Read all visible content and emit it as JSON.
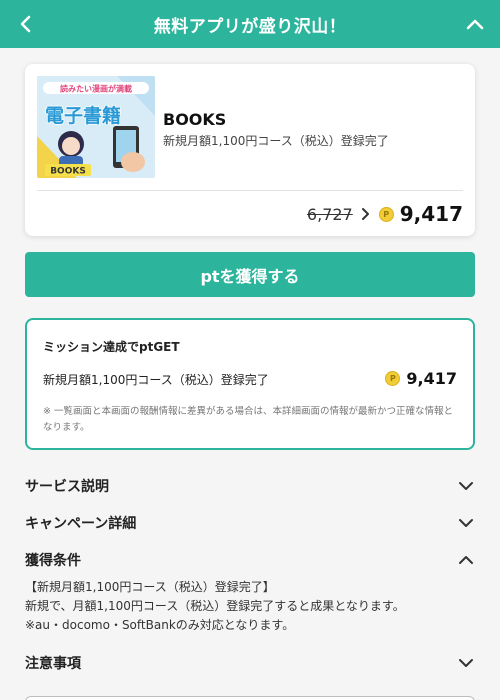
{
  "header": {
    "title": "無料アプリが盛り沢山！",
    "color": "#2cb59c"
  },
  "product": {
    "thumb_text_top": "読みたい漫画が満載",
    "thumb_text_main": "電子書籍",
    "thumb_text_badge": "BOOKS",
    "name": "BOOKS",
    "course": "新規月額1,100円コース（税込）登録完了",
    "old_price": "6,727",
    "new_price": "9,417"
  },
  "cta": {
    "label": "ptを獲得する"
  },
  "mission": {
    "title": "ミッション達成でptGET",
    "course": "新規月額1,100円コース（税込）登録完了",
    "points": "9,417",
    "note": "※ 一覧画面と本画面の報酬情報に差異がある場合は、本詳細画面の情報が最新かつ正確な情報となります。"
  },
  "sections": {
    "service": "サービス説明",
    "campaign": "キャンペーン詳細",
    "conditions": "獲得条件",
    "notes": "注意事項"
  },
  "conditions": {
    "line1": "【新規月額1,100円コース（税込）登録完了】",
    "line2": "新規で、月額1,100円コース（税込）登録完了すると成果となります。",
    "line3": "※au・docomo・SoftBankのみ対応となります。"
  },
  "icons": {
    "back": "chevron-left-icon",
    "collapse": "chevron-up-icon",
    "coin": "point-coin-icon"
  }
}
